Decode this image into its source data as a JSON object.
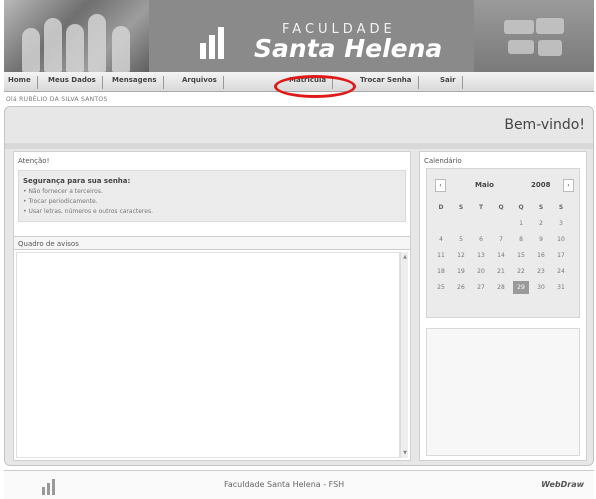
{
  "banner": {
    "subtitle": "FACULDADE",
    "title": "Santa Helena"
  },
  "menu": [
    {
      "label": "Home"
    },
    {
      "label": "Meus Dados"
    },
    {
      "label": "Mensagens"
    },
    {
      "label": "Arquivos"
    },
    {
      "label": "Matrícula"
    },
    {
      "label": "Trocar Senha"
    },
    {
      "label": "Sair"
    }
  ],
  "user_line": "Olá RUBÉLIO DA SILVA SANTOS",
  "welcome": "Bem-vindo!",
  "attention": {
    "title": "Atenção!",
    "heading": "Segurança para sua senha:",
    "tips": [
      "• Não fornecer a terceiros.",
      "• Trocar periodicamente.",
      "• Usar letras, números e outros caracteres."
    ]
  },
  "notices": {
    "title": "Quadro de avisos"
  },
  "calendar": {
    "title": "Calendário",
    "prev": "‹",
    "next": "›",
    "month": "Maio",
    "year": "2008",
    "weekdays": [
      "D",
      "S",
      "T",
      "Q",
      "Q",
      "S",
      "S"
    ],
    "weeks": [
      [
        "",
        "",
        "",
        "",
        "1",
        "2",
        "3"
      ],
      [
        "4",
        "5",
        "6",
        "7",
        "8",
        "9",
        "10"
      ],
      [
        "11",
        "12",
        "13",
        "14",
        "15",
        "16",
        "17"
      ],
      [
        "18",
        "19",
        "20",
        "21",
        "22",
        "23",
        "24"
      ],
      [
        "25",
        "26",
        "27",
        "28",
        "29",
        "30",
        "31"
      ]
    ],
    "today": "29"
  },
  "footer": {
    "text": "Faculdade Santa Helena - FSH",
    "brand": "WebDraw"
  },
  "colors": {
    "highlight": "#e01818",
    "banner": "#8a8a8a"
  }
}
